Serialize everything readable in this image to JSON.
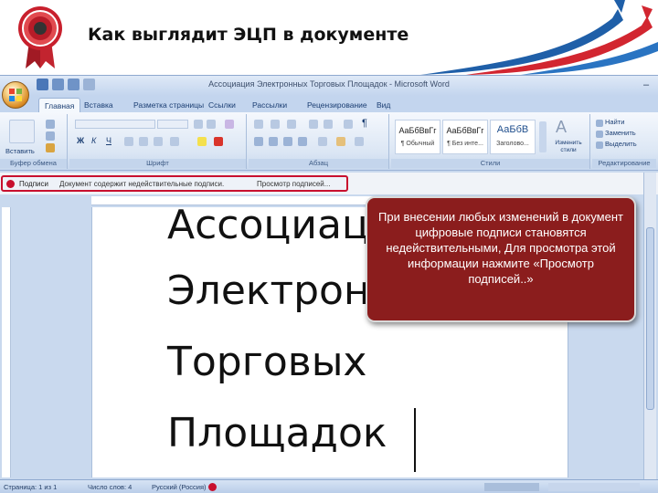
{
  "slide": {
    "title": "Как выглядит ЭЦП в документе"
  },
  "window": {
    "title": "Ассоциация Электронных Торговых Площадок - Microsoft Word"
  },
  "tabs": [
    {
      "label": "Главная"
    },
    {
      "label": "Вставка"
    },
    {
      "label": "Разметка страницы"
    },
    {
      "label": "Ссылки"
    },
    {
      "label": "Рассылки"
    },
    {
      "label": "Рецензирование"
    },
    {
      "label": "Вид"
    }
  ],
  "ribbon": {
    "clipboard_label": "Буфер обмена",
    "paste_label": "Вставить",
    "font_label": "Шрифт",
    "paragraph_label": "Абзац",
    "styles_label": "Стили",
    "editing_label": "Редактирование",
    "styles": [
      {
        "sample": "АаБбВвГг",
        "name": "¶ Обычный"
      },
      {
        "sample": "АаБбВвГг",
        "name": "¶ Без инте..."
      },
      {
        "sample": "АаБбВ",
        "name": "Заголово..."
      }
    ],
    "change_styles": "Изменить стили",
    "find": "Найти",
    "replace": "Заменить",
    "select": "Выделить"
  },
  "message_bar": {
    "label": "Подписи",
    "text": "Документ содержит недействительные подписи.",
    "link": "Просмотр подписей..."
  },
  "document": {
    "lines": [
      "Ассоциация",
      "Электронных",
      "Торговых",
      "Площадок"
    ]
  },
  "callout": {
    "text": "При внесении любых изменений в документ цифровые подписи становятся  недействительными, Для просмотра этой информации нажмите «Просмотр подписей..»"
  },
  "status": {
    "page": "Страница: 1 из 1",
    "words": "Число слов: 4",
    "language": "Русский (Россия)"
  },
  "colors": {
    "callout_bg": "#8b1d1d",
    "highlight": "#c8102e",
    "ribbon": "#dbe6f4"
  }
}
